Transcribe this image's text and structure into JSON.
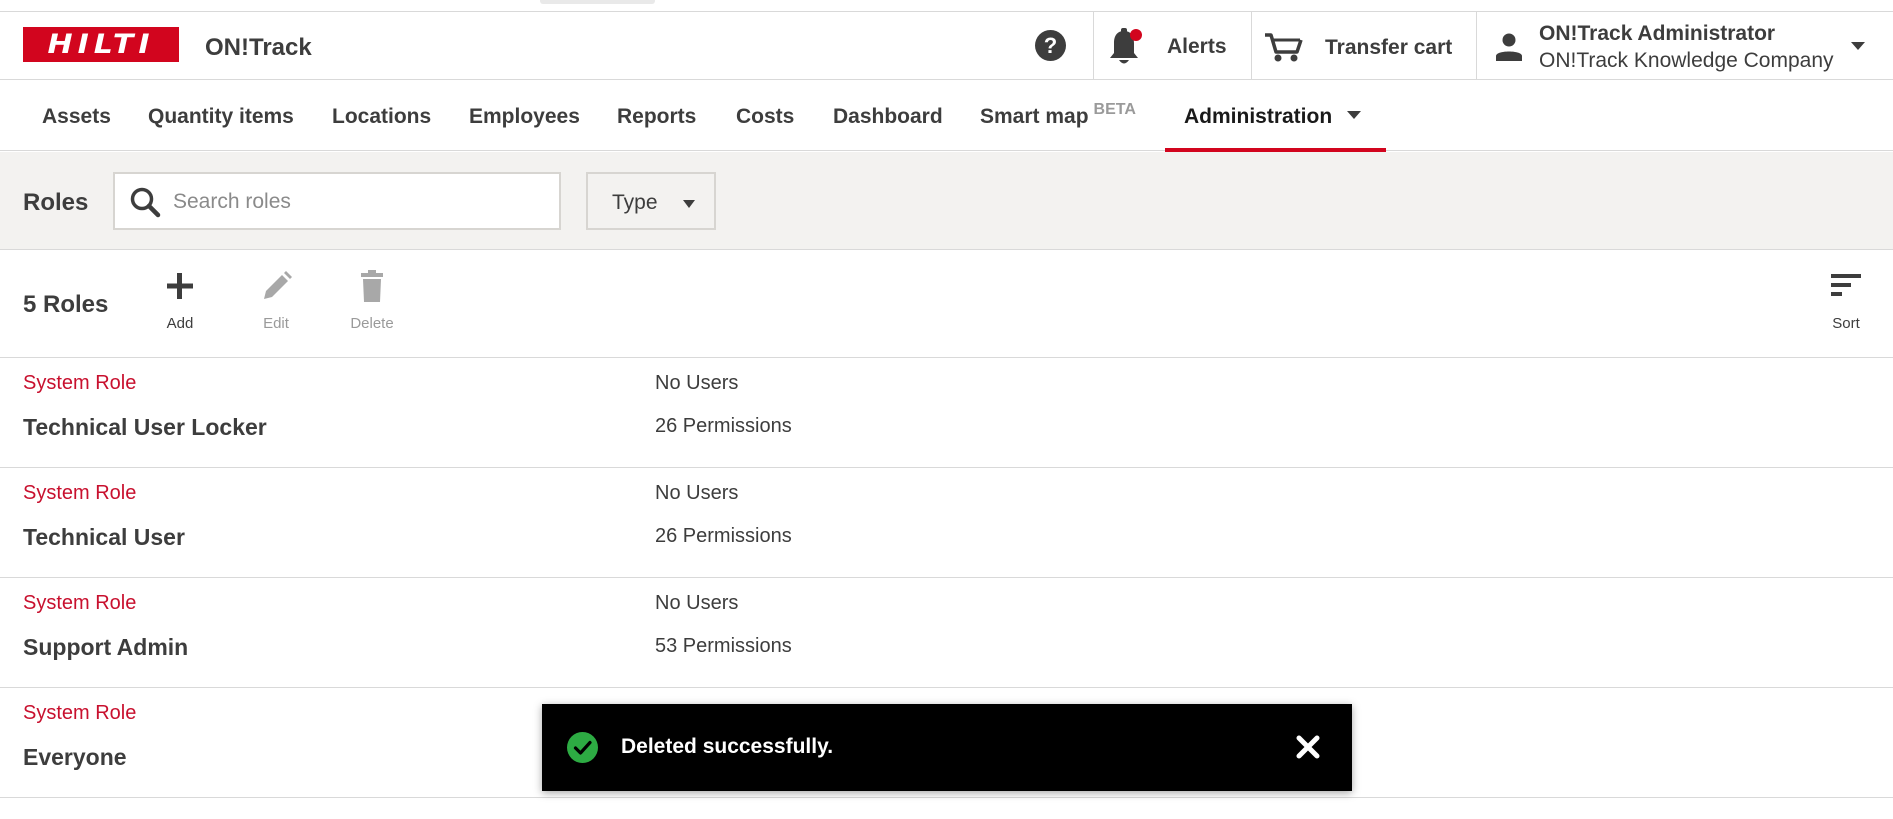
{
  "header": {
    "logo_text": "HILTI",
    "app_name": "ON!Track",
    "help_label": "?",
    "alerts_label": "Alerts",
    "transfer_cart_label": "Transfer cart",
    "user_name": "ON!Track Administrator",
    "user_company": "ON!Track Knowledge Company",
    "icons": [
      "help-icon",
      "bell-icon",
      "cart-icon",
      "user-icon",
      "chevron-down-icon"
    ]
  },
  "nav": {
    "items": [
      {
        "label": "Assets"
      },
      {
        "label": "Quantity items"
      },
      {
        "label": "Locations"
      },
      {
        "label": "Employees"
      },
      {
        "label": "Reports"
      },
      {
        "label": "Costs"
      },
      {
        "label": "Dashboard"
      },
      {
        "label": "Smart map",
        "badge": "BETA"
      },
      {
        "label": "Administration",
        "active": true
      }
    ]
  },
  "filterbar": {
    "title": "Roles",
    "search_placeholder": "Search roles",
    "search_value": "",
    "type_label": "Type"
  },
  "toolbar": {
    "count_label": "5 Roles",
    "add_label": "Add",
    "edit_label": "Edit",
    "delete_label": "Delete",
    "sort_label": "Sort"
  },
  "roles": [
    {
      "type": "System Role",
      "name": "Technical User Locker",
      "users": "No Users",
      "permissions": "26 Permissions"
    },
    {
      "type": "System Role",
      "name": "Technical User",
      "users": "No Users",
      "permissions": "26 Permissions"
    },
    {
      "type": "System Role",
      "name": "Support Admin",
      "users": "No Users",
      "permissions": "53 Permissions"
    },
    {
      "type": "System Role",
      "name": "Everyone",
      "users": "",
      "permissions": ""
    }
  ],
  "toast": {
    "message": "Deleted successfully."
  },
  "colors": {
    "brand_red": "#d2051e",
    "role_type_red": "#c8102e",
    "success_green": "#2dab43",
    "text_dark": "#3d3d3d",
    "filter_bg": "#f3f2f0"
  }
}
